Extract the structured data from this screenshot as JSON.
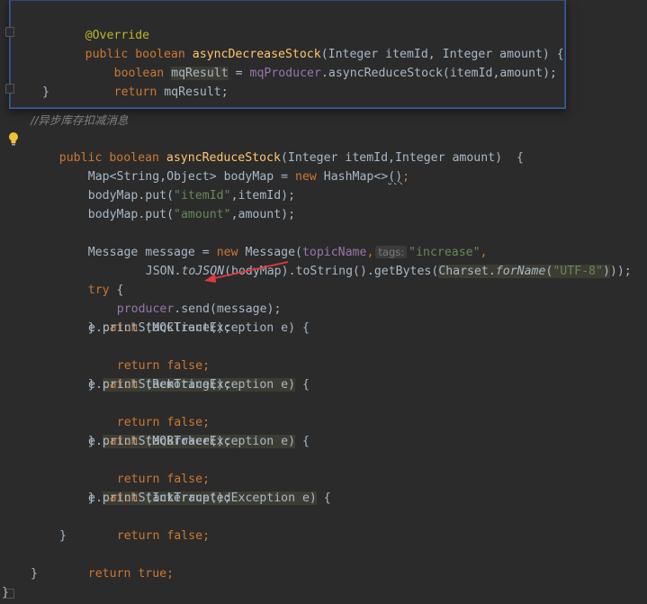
{
  "popup": {
    "line1": {
      "ann": "@Override"
    },
    "line2": {
      "kw1": "public",
      "kw2": "boolean",
      "name": "asyncDecreaseStock",
      "params": "(Integer itemId, Integer amount) {"
    },
    "line3": {
      "kw": "boolean",
      "var": "mqResult",
      "eq": " = ",
      "field": "mqProducer",
      "call": ".asyncReduceStock(itemId,amount);"
    },
    "line4": {
      "kw": "return",
      "rest": " mqResult;"
    },
    "line5": {
      "text": "}"
    }
  },
  "code": {
    "comment": "//异步库存扣减消息",
    "sig": {
      "kw1": "public",
      "kw2": "boolean",
      "name": "asyncReduceStock",
      "params": "(Integer itemId,Integer amount)  {"
    },
    "map_decl": {
      "pre": "Map<String,Object> bodyMap = ",
      "kw": "new",
      "post": " HashMap<>",
      "paren": "()",
      "end": ";"
    },
    "put1": {
      "pre": "bodyMap.put(",
      "str": "\"itemId\"",
      "post": ",itemId);"
    },
    "put2": {
      "pre": "bodyMap.put(",
      "str": "\"amount\"",
      "post": ",amount);"
    },
    "msg1": {
      "pre": "Message message = ",
      "kw": "new",
      "post": " Message(",
      "field": "topicName",
      "comma": ",",
      "hint": "tags:",
      "str": "\"increase\"",
      "end": ","
    },
    "msg2": {
      "pre": "JSON.",
      "method": "toJSON",
      "mid": "(bodyMap).toString().getBytes(",
      "cls": "Charset.",
      "method2": "forName",
      "p1": "(",
      "str": "\"UTF-8\"",
      "p2": ")",
      "end": "));"
    },
    "try": {
      "kw": "try",
      "rest": " {"
    },
    "send": {
      "field": "producer",
      "rest": ".send(message);"
    },
    "catch1": {
      "pre": "} ",
      "kw": "catch",
      "rest": " (MQClientException e) {"
    },
    "print": "e.printStackTrace();",
    "ret_false": {
      "kw": "return",
      "val": "false",
      "end": ";"
    },
    "catch2": {
      "pre": "} ",
      "kw": "catch",
      "rest": " (RemotingException e)",
      "end": " {"
    },
    "catch3": {
      "pre": "} ",
      "kw": "catch",
      "rest": " (MQBrokerException e)",
      "end": " {"
    },
    "catch4": {
      "pre": "} ",
      "kw": "catch",
      "rest": " (InterruptedException e)",
      "end": " {"
    },
    "close_try": "}",
    "ret_true": {
      "kw": "return",
      "val": "true",
      "end": ";"
    },
    "close_method": "}",
    "close_class": "}"
  },
  "colors": {
    "background": "#2b2b2b",
    "keyword": "#cc7832",
    "function": "#ffc66d",
    "string": "#6a8759",
    "field": "#9876aa",
    "annotation": "#bbb529",
    "arrow": "#e0393e"
  },
  "icons": {
    "bulb": "lightbulb-icon",
    "arrow": "red-annotation-arrow"
  }
}
